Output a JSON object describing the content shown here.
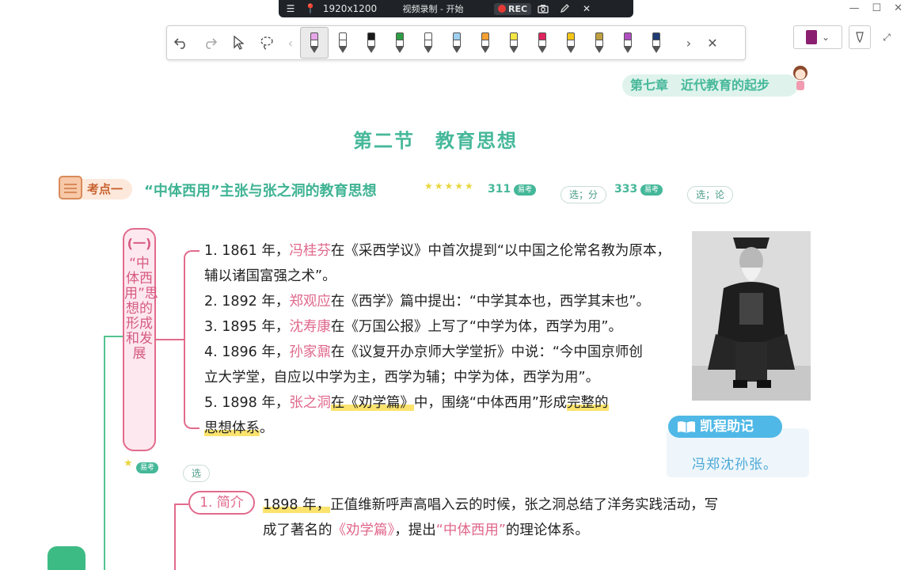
{
  "recording_bar": {
    "menu_icon": "hamburger-icon",
    "pin_icon": "pin-icon",
    "resolution": "1920x1200",
    "title": "视频录制 - 开始",
    "rec_label": "REC",
    "close_glyph": "✕"
  },
  "topright": {
    "minimize": "—",
    "maximize": "☐",
    "close": "✕"
  },
  "toolbar": {
    "tools": [
      "undo-icon",
      "redo-icon",
      "cursor-icon",
      "lasso-icon"
    ],
    "prev": "‹",
    "next": "›",
    "close": "✕",
    "pens": [
      {
        "name": "highlighter-pink",
        "color": "#e6a6e8"
      },
      {
        "name": "pencil-outline",
        "color": "#ffffff"
      },
      {
        "name": "marker-black",
        "color": "#1a1a1a"
      },
      {
        "name": "marker-green",
        "color": "#2e9e46"
      },
      {
        "name": "pencil-white",
        "color": "#ffffff"
      },
      {
        "name": "highlighter-blue",
        "color": "#9fd0f0"
      },
      {
        "name": "highlighter-orange",
        "color": "#f5a033"
      },
      {
        "name": "highlighter-yellow",
        "color": "#f5e642"
      },
      {
        "name": "marker-red",
        "color": "#e0245e"
      },
      {
        "name": "pencil-yellow",
        "color": "#f5c518"
      },
      {
        "name": "pencil-rainbow",
        "color": "#c0a040"
      },
      {
        "name": "brush-purple",
        "color": "#b04fc0"
      },
      {
        "name": "fountain-pen-navy",
        "color": "#1f3b73"
      }
    ]
  },
  "page": {
    "chapter": "第七章　近代教育的起步",
    "section_title": "第二节　教育思想",
    "topic": {
      "tag": "考点一",
      "title": "“中体西用”主张与张之洞的教育思想",
      "stars": "★★★★★",
      "num1": "311",
      "num2": "333",
      "exam_badge": "易考",
      "bubble1": "选；分",
      "bubble2": "选；论"
    },
    "branch": {
      "number": "(一)",
      "label": "“中体西用”思想的形成和发展",
      "lines": [
        {
          "pre": "1. 1861 年，",
          "name": "冯桂芬",
          "post": "在《采西学议》中首次提到“以中国之伦常名教为原本，"
        },
        {
          "pre": "",
          "name": "",
          "post": "辅以诸国富强之术”。"
        },
        {
          "pre": "2. 1892 年，",
          "name": "郑观应",
          "post": "在《西学》篇中提出：“中学其本也，西学其末也”。"
        },
        {
          "pre": "3. 1895 年，",
          "name": "沈寿康",
          "post": "在《万国公报》上写了“中学为体，西学为用”。"
        },
        {
          "pre": "4. 1896 年，",
          "name": "孙家鼐",
          "post": "在《议复开办京师大学堂折》中说：“今中国京师创"
        },
        {
          "pre": "",
          "name": "",
          "post": "立大学堂，自应以中学为主，西学为辅；中学为体，西学为用”。"
        }
      ],
      "line5": {
        "pre": "5. 1898 年，",
        "name": "张之洞",
        "mid1": "在",
        "book": "《劝学篇》",
        "mid2": "中，围绕“中体西用”形成",
        "hl": "完整的",
        "line2": "思想体系",
        "end": "。"
      }
    },
    "memory": {
      "tag": "凯程助记",
      "text": "冯郑沈孙张。"
    },
    "exam2": {
      "badge": "易考",
      "bubble": "选"
    },
    "intro": {
      "tag": "1. 简介",
      "year": "1898 年，",
      "text1": "正值维新呼声高唱入云的时候，张之洞总结了洋务实践活动，写",
      "text2a": "成了著名的",
      "book": "《劝学篇》",
      "text2b": "，提出",
      "term": "“中体西用”",
      "text2c": "的理论体系。"
    }
  }
}
